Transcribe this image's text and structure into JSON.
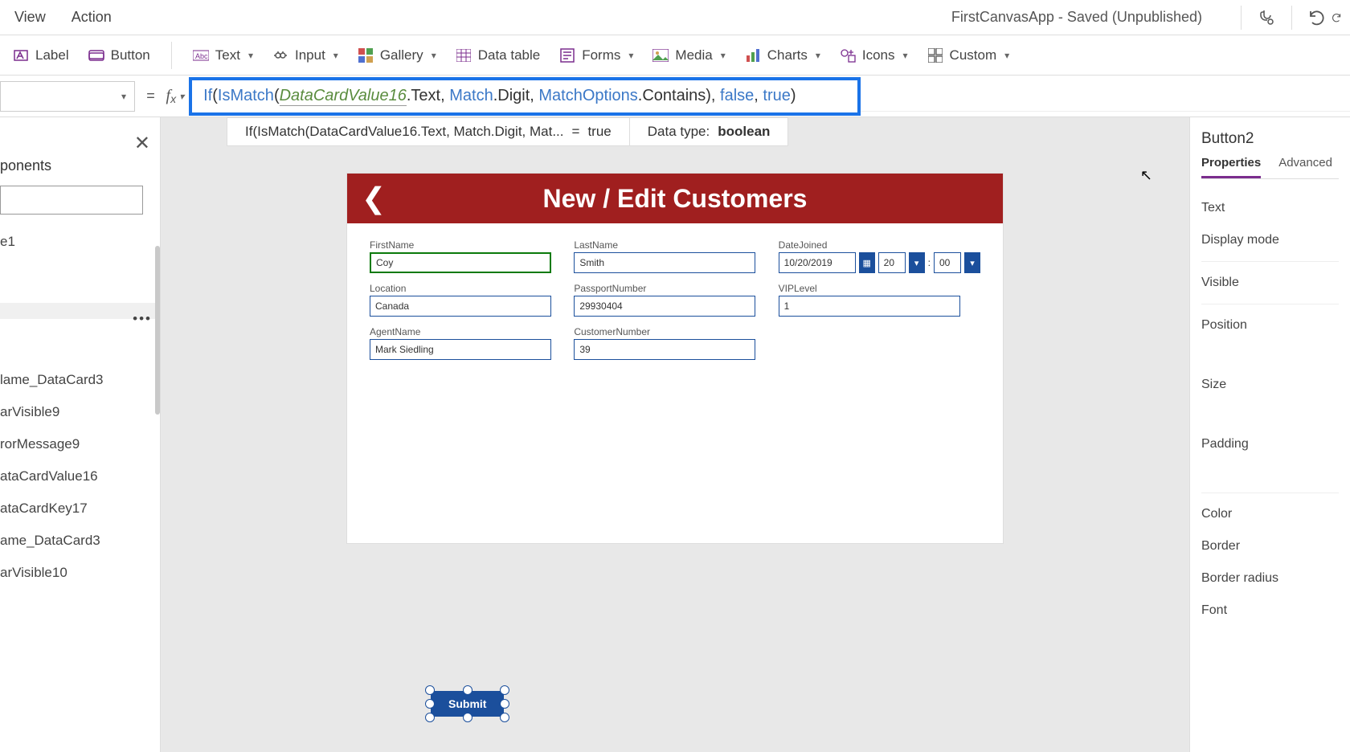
{
  "menubar": {
    "items": [
      "View",
      "Action"
    ],
    "app_title": "FirstCanvasApp - Saved (Unpublished)"
  },
  "ribbon": {
    "label": "Label",
    "button": "Button",
    "text": "Text",
    "input": "Input",
    "gallery": "Gallery",
    "datatable": "Data table",
    "forms": "Forms",
    "media": "Media",
    "charts": "Charts",
    "icons": "Icons",
    "custom": "Custom"
  },
  "formula": {
    "kw_if": "If",
    "p1": "(",
    "kw_ismatch": "IsMatch",
    "p2": "(",
    "id": "DataCardValue16",
    "dot_text": ".Text, ",
    "match": "Match",
    "dot_digit": ".Digit, ",
    "matchopt": "MatchOptions",
    "dot_contains": ".Contains), ",
    "false": "false",
    "comma": ", ",
    "true": "true",
    "p3": ")"
  },
  "eval": {
    "expr": "If(IsMatch(DataCardValue16.Text, Match.Digit, Mat...",
    "eq": "=",
    "result": "true",
    "datatype_label": "Data type: ",
    "datatype_value": "boolean"
  },
  "leftpanel": {
    "header": "ponents",
    "item0": "e1",
    "tree": [
      "lame_DataCard3",
      "arVisible9",
      "rorMessage9",
      "ataCardValue16",
      "ataCardKey17",
      "ame_DataCard3",
      "arVisible10"
    ]
  },
  "canvas": {
    "title": "New / Edit Customers",
    "fields": {
      "firstname_label": "FirstName",
      "firstname_value": "Coy",
      "lastname_label": "LastName",
      "lastname_value": "Smith",
      "datejoined_label": "DateJoined",
      "datejoined_value": "10/20/2019",
      "hour": "20",
      "minute": "00",
      "location_label": "Location",
      "location_value": "Canada",
      "passport_label": "PassportNumber",
      "passport_value": "29930404",
      "vip_label": "VIPLevel",
      "vip_value": "1",
      "agent_label": "AgentName",
      "agent_value": "Mark Siedling",
      "custnum_label": "CustomerNumber",
      "custnum_value": "39"
    },
    "submit": "Submit"
  },
  "rightpanel": {
    "selected": "Button2",
    "tab_props": "Properties",
    "tab_adv": "Advanced",
    "rows": [
      "Text",
      "Display mode",
      "Visible",
      "Position",
      "Size",
      "Padding",
      "Color",
      "Border",
      "Border radius",
      "Font"
    ]
  }
}
